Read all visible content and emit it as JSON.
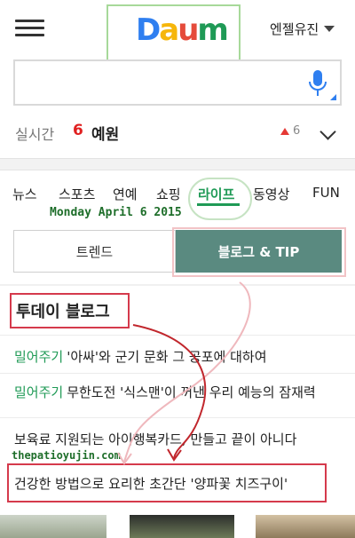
{
  "header": {
    "logo_text": "Daum",
    "logo_colors": [
      "#2f7ff0",
      "#f6b60b",
      "#e54b3b",
      "#1f9a56",
      "#e54b3b"
    ],
    "user_name": "엔젤유진"
  },
  "search": {
    "value": "",
    "placeholder": ""
  },
  "realtime": {
    "label": "실시간",
    "rank": "6",
    "term": "예원",
    "change": "6"
  },
  "tabs": [
    {
      "label": "뉴스",
      "active": false
    },
    {
      "label": "스포츠",
      "active": false
    },
    {
      "label": "연예",
      "active": false
    },
    {
      "label": "쇼핑",
      "active": false
    },
    {
      "label": "라이프",
      "active": true
    },
    {
      "label": "동영상",
      "active": false
    },
    {
      "label": "FUN",
      "active": false
    }
  ],
  "overlay": {
    "date": "Monday April 6 2015",
    "watermark": "thepatioyujin.com"
  },
  "segment": {
    "left": "트렌드",
    "right": "블로그 & TIP"
  },
  "section": {
    "title": "투데이 블로그"
  },
  "items": [
    {
      "tag": "밀어주기",
      "text": "'아싸'와 군기 문화 그 공포에 대하여"
    },
    {
      "tag": "밀어주기",
      "text": "무한도전 '식스맨'이 꺼낸 우리 예능의 잠재력"
    },
    {
      "tag": "",
      "text": "보육료 지원되는 아이행복카드, 만들고 끝이 아니다"
    },
    {
      "tag": "",
      "text": "건강한 방법으로 요리한 초간단 '양파꽃 치즈구이'"
    }
  ],
  "colors": {
    "accent_green": "#1f9a56",
    "segment_active": "#5a8a80",
    "annotation_red": "#d53a4c"
  }
}
